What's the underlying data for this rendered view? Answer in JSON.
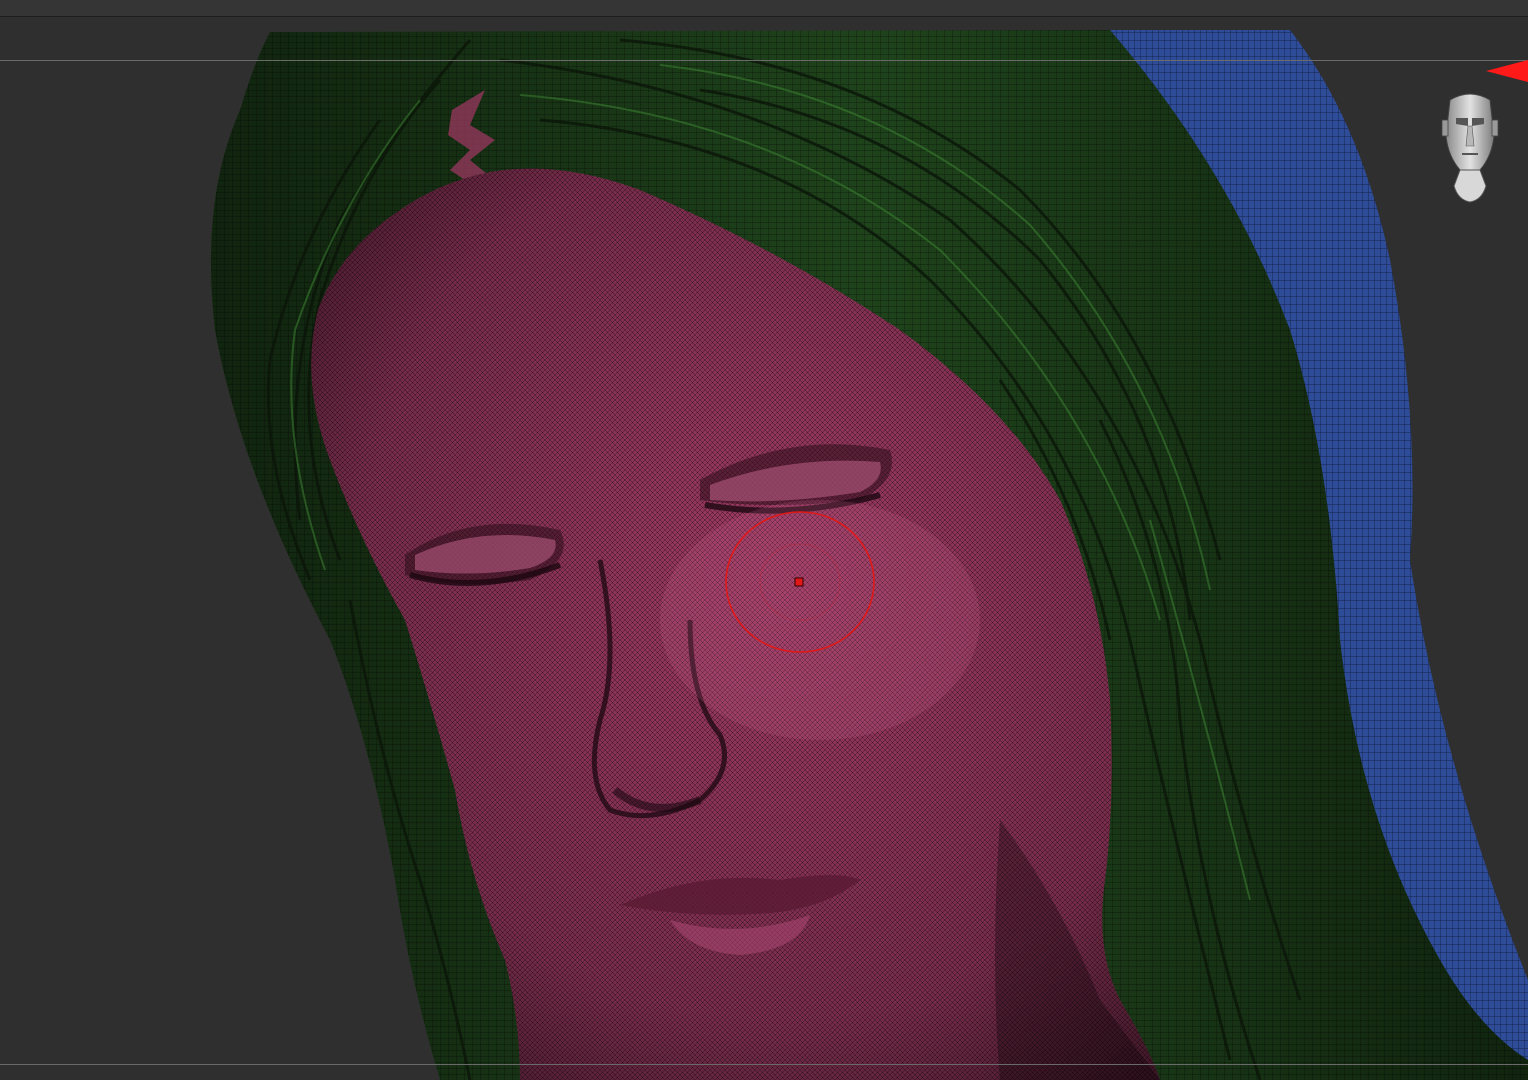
{
  "app": {
    "accent_color": "#ff1a1a",
    "viewport_background": "#2f2f2f"
  },
  "scene": {
    "polygroups": [
      {
        "name": "face",
        "color": "#b0406e"
      },
      {
        "name": "hair-front",
        "color": "#2f6a2a"
      },
      {
        "name": "hair-back",
        "color": "#2c4b9a"
      }
    ],
    "display_mode": "polyframe"
  },
  "navigation": {
    "icon": "head-gizmo-icon"
  },
  "brush": {
    "icon": "brush-cursor-icon",
    "color": "#e01818"
  },
  "marker": {
    "icon": "red-triangle-icon",
    "color": "#ff1a1a"
  }
}
